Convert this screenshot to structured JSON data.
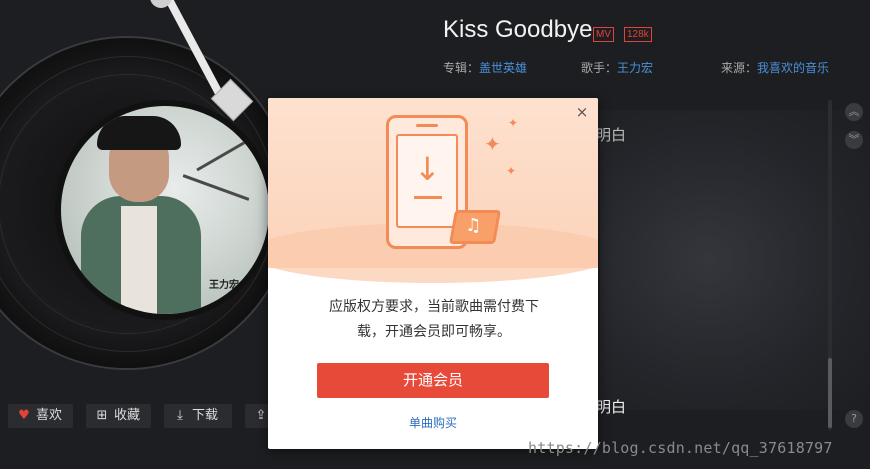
{
  "song": {
    "title": "Kiss Goodbye",
    "badge_mv": "MV",
    "badge_quality": "128k",
    "album_label": "专辑：",
    "album": "盖世英雄",
    "artist_label": "歌手：",
    "artist": "王力宏",
    "source_label": "来源：",
    "source": "我喜欢的音乐"
  },
  "cover": {
    "signature": "王力宏"
  },
  "lyrics": {
    "line_top_fragment": "明白",
    "line_bottom_fragment": "明白"
  },
  "actions": {
    "like_label": "喜欢",
    "collect_label": "收藏",
    "download_label": "下载"
  },
  "modal": {
    "message": "应版权方要求，当前歌曲需付费下载，开通会员即可畅享。",
    "primary_label": "开通会员",
    "secondary_label": "单曲购买",
    "close_glyph": "×"
  },
  "watermark": "https://blog.csdn.net/qq_37618797",
  "colors": {
    "accent": "#e84a3a",
    "link": "#2b6cbf",
    "badge": "#e0433a",
    "hero_orange": "#f28b55"
  }
}
